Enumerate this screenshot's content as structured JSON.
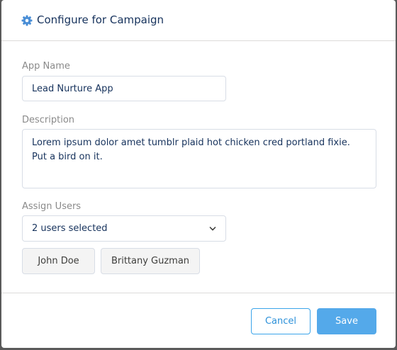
{
  "header": {
    "icon": "gear-icon",
    "title": "Configure for Campaign"
  },
  "form": {
    "app_name": {
      "label": "App Name",
      "value": "Lead Nurture App"
    },
    "description": {
      "label": "Description",
      "value": "Lorem ipsum dolor amet tumblr plaid hot chicken cred portland fixie. Put a bird on it."
    },
    "assign_users": {
      "label": "Assign Users",
      "selected": "2 users selected",
      "chevron_icon": "chevron-down-icon",
      "users": [
        "John Doe",
        "Brittany Guzman"
      ]
    }
  },
  "footer": {
    "cancel_label": "Cancel",
    "save_label": "Save"
  },
  "colors": {
    "accent": "#54a9ea",
    "title": "#16325c",
    "label": "#8a8a8a",
    "header_icon": "#4a8ed6"
  }
}
